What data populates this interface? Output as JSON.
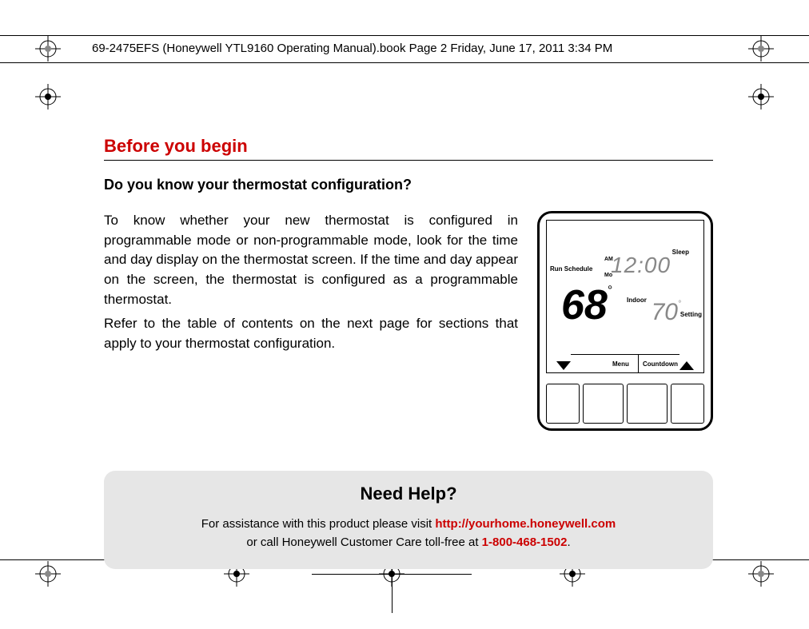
{
  "header": {
    "text": "69-2475EFS (Honeywell YTL9160 Operating Manual).book  Page 2  Friday, June 17, 2011  3:34 PM"
  },
  "section": {
    "title": "Before you begin",
    "subtitle": "Do you know your thermostat configuration?",
    "p1": "To know whether your new thermostat is configured in programmable mode or non-programmable mode, look for the time and day display on the thermostat screen. If the time and day appear on the screen, the thermostat is configured as a programmable thermostat.",
    "p2": "Refer to the table of contents on the next page for sections that apply to your thermostat configuration."
  },
  "thermostat": {
    "run": "Run Schedule",
    "sleep": "Sleep",
    "am": "AM",
    "mo": "Mo",
    "time": "12:00",
    "indoor": "Indoor",
    "big": "68",
    "setting": "Setting",
    "small": "70",
    "menu": "Menu",
    "countdown": "Countdown"
  },
  "help": {
    "title": "Need Help?",
    "line1_a": "For assistance with this product please visit ",
    "url": "http://yourhome.honeywell.com",
    "line2_a": "or call Honeywell Customer Care toll-free at ",
    "phone": "1-800-468-1502",
    "period": "."
  }
}
